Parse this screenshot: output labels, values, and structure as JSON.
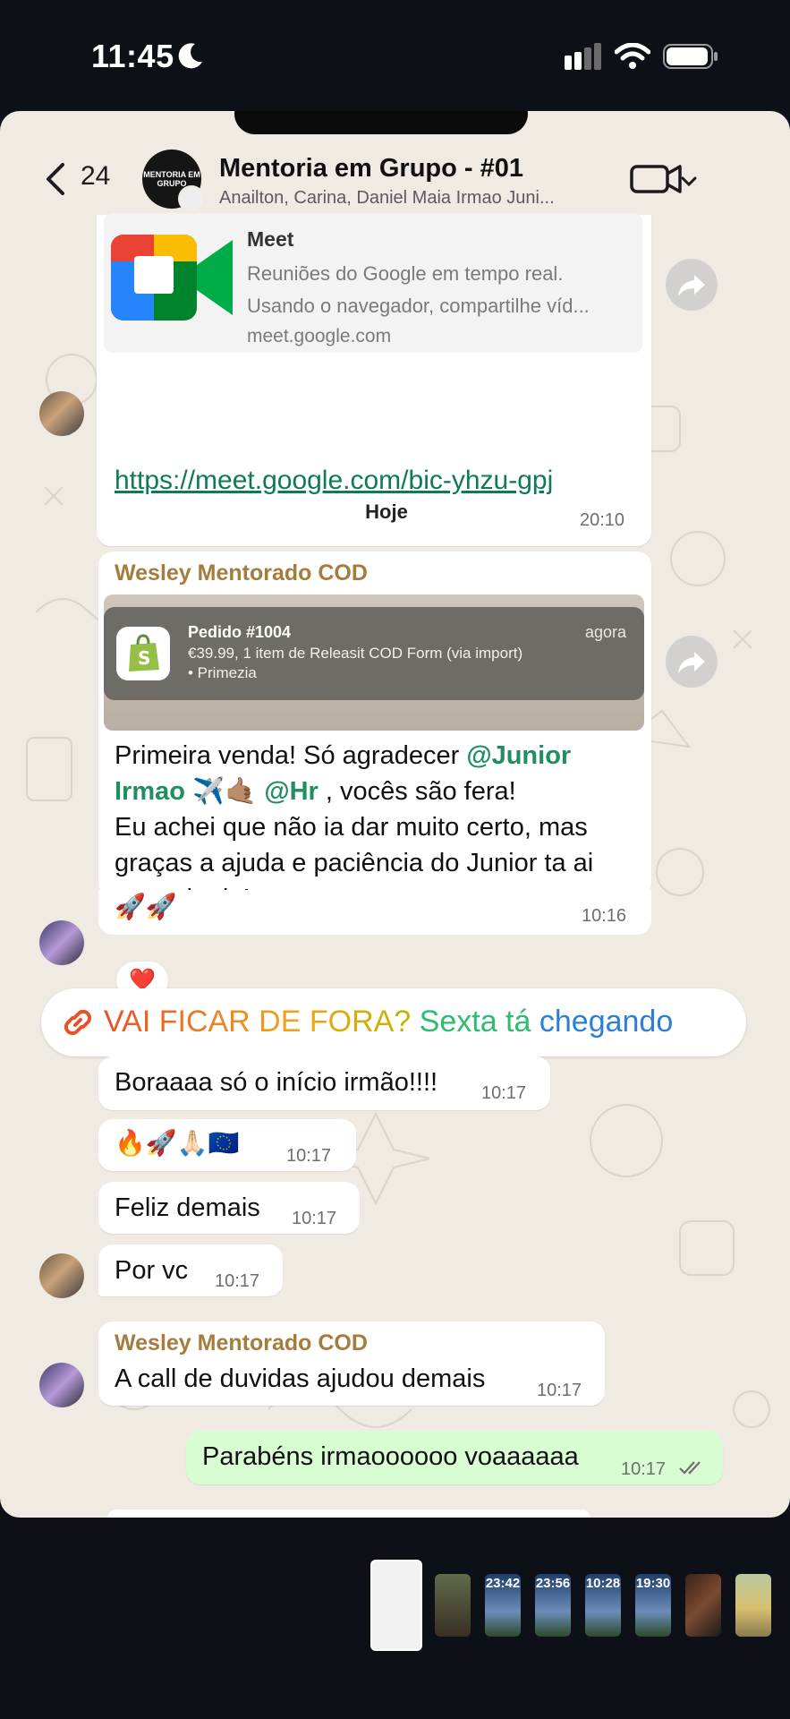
{
  "status_bar": {
    "time": "11:45"
  },
  "header": {
    "back_count": "24",
    "group_avatar_text": "MENTORIA EM GRUPO",
    "title": "Mentoria em Grupo - #01",
    "subtitle": "Anailton, Carina, Daniel Maia Irmao Juni..."
  },
  "messages": {
    "link_preview": {
      "title": "Meet",
      "desc_line1": "Reuniões do Google em tempo real.",
      "desc_line2": "Usando o navegador, compartilhe víd...",
      "domain": "meet.google.com",
      "link": "https://meet.google.com/bic-yhzu-gpj",
      "time": "20:10"
    },
    "date_divider": "Hoje",
    "first_sale": {
      "sender": "Wesley Mentorado COD",
      "notification": {
        "title": "Pedido #1004",
        "line1": "€39.99, 1 item de Releasit COD Form (via import)",
        "line2": "• Primezia",
        "time": "agora"
      },
      "text_pre": "Primeira venda! Só agradecer ",
      "mention1_a": "@Junior",
      "mention1_b": "Irmao",
      "mention1_emoji": "✈️🤙🏽",
      "mention2": "@Hr",
      "text_mid": " , vocês são fera!",
      "line3": "Eu achei que não ia dar muito certo, mas",
      "line4": "graças a ajuda e paciência do Junior ta ai",
      "line5": "o resultado!",
      "emojis": "🚀🚀",
      "time": "10:16",
      "reaction": "❤️"
    },
    "banner": {
      "part1": "VAI FICAR DE FORA?",
      "part2": "Sexta tá",
      "part3": "chegando"
    },
    "m1": {
      "text": "Boraaaa só o início irmão!!!!",
      "time": "10:17"
    },
    "m2": {
      "text": "🔥🚀🙏🏻🇪🇺",
      "time": "10:17"
    },
    "m3": {
      "text": "Feliz demais",
      "time": "10:17"
    },
    "m4": {
      "text": "Por vc",
      "time": "10:17"
    },
    "m5": {
      "sender": "Wesley Mentorado COD",
      "text": "A call de duvidas ajudou demais",
      "time": "10:17"
    },
    "m6": {
      "text": "Parabéns irmaoooooo voaaaaaa",
      "time": "10:17"
    }
  },
  "thumbnails": {
    "t3": "23:42",
    "t4": "23:56",
    "t5": "10:28",
    "t6": "19:30"
  },
  "colors": {
    "chat_bg": "#efeae2",
    "outgoing_bubble": "#d9fdd3",
    "sender_name": "#a67c3d",
    "mention": "#1f8f5f"
  }
}
